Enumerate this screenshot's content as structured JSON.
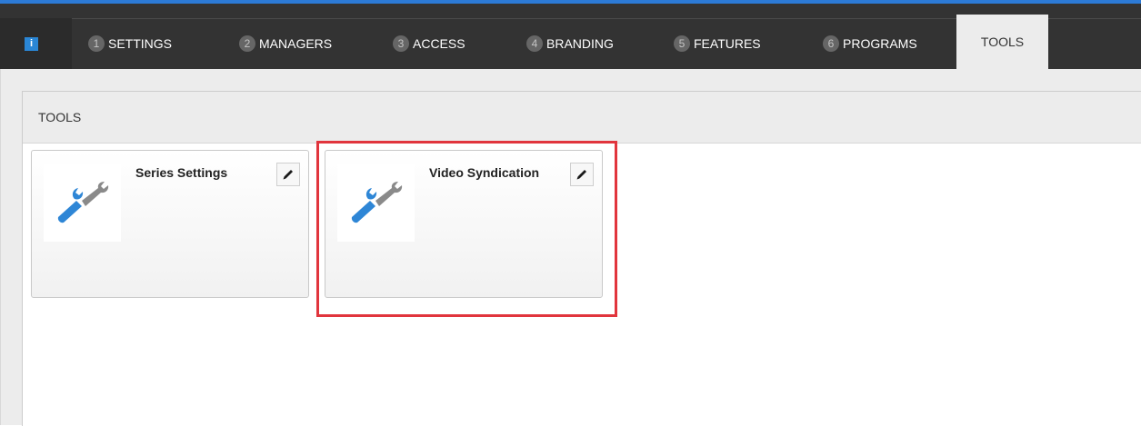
{
  "nav": {
    "info_label": "i",
    "tabs": [
      {
        "number": "1",
        "label": "SETTINGS"
      },
      {
        "number": "2",
        "label": "MANAGERS"
      },
      {
        "number": "3",
        "label": "ACCESS"
      },
      {
        "number": "4",
        "label": "BRANDING"
      },
      {
        "number": "5",
        "label": "FEATURES"
      },
      {
        "number": "6",
        "label": "PROGRAMS"
      }
    ],
    "active_tab": "TOOLS"
  },
  "panel": {
    "title": "TOOLS",
    "cards": [
      {
        "title": "Series Settings",
        "icon": "wrench-icon"
      },
      {
        "title": "Video Syndication",
        "icon": "wrench-icon"
      }
    ]
  },
  "colors": {
    "accent": "#2c7ad6",
    "navbar": "#333333",
    "highlight": "#e1353d",
    "wrench_blue": "#2e86d6",
    "wrench_gray": "#8a8a8a"
  }
}
